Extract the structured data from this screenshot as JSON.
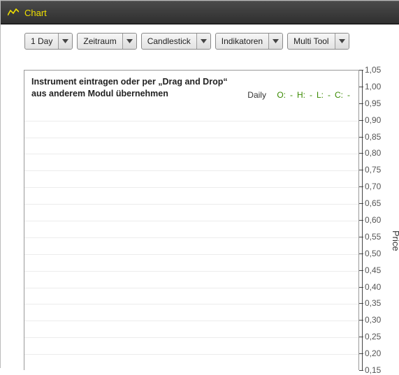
{
  "header": {
    "title": "Chart"
  },
  "toolbar": {
    "items": [
      {
        "label": "1 Day"
      },
      {
        "label": "Zeitraum"
      },
      {
        "label": "Candlestick"
      },
      {
        "label": "Indikatoren"
      },
      {
        "label": "Multi Tool"
      }
    ]
  },
  "chart": {
    "instruction": "Instrument eintragen oder per „Drag and Drop“ aus anderem Modul übernehmen",
    "interval": "Daily",
    "ohlc": {
      "o_label": "O:",
      "o_val": "-",
      "h_label": "H:",
      "h_val": "-",
      "l_label": "L:",
      "l_val": "-",
      "c_label": "C:",
      "c_val": "-"
    },
    "yaxis_label": "Price"
  },
  "chart_data": {
    "type": "line",
    "series": [],
    "title": "",
    "xlabel": "",
    "ylabel": "Price",
    "ylim": [
      0.15,
      1.05
    ],
    "yticks": [
      1.05,
      1.0,
      0.95,
      0.9,
      0.85,
      0.8,
      0.75,
      0.7,
      0.65,
      0.6,
      0.55,
      0.5,
      0.45,
      0.4,
      0.35,
      0.3,
      0.25,
      0.2,
      0.15
    ],
    "ytick_labels": [
      "1,05",
      "1,00",
      "0,95",
      "0,90",
      "0,85",
      "0,80",
      "0,75",
      "0,70",
      "0,65",
      "0,60",
      "0,55",
      "0,50",
      "0,45",
      "0,40",
      "0,35",
      "0,30",
      "0,25",
      "0,20",
      "0,15"
    ]
  }
}
